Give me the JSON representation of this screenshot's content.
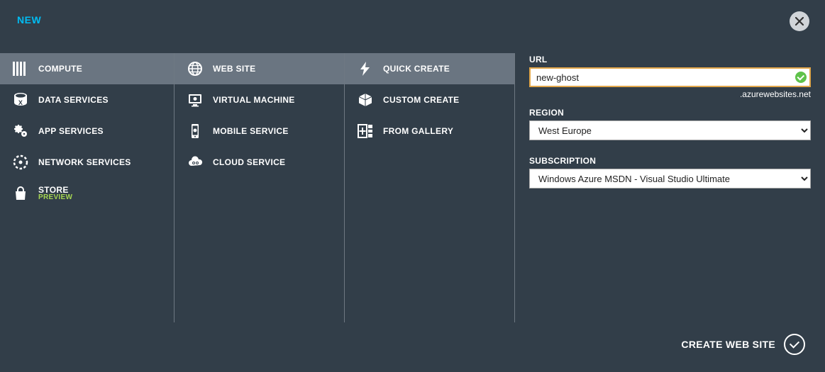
{
  "header": {
    "title": "NEW"
  },
  "col1": {
    "items": [
      {
        "label": "COMPUTE",
        "selected": true,
        "icon": "compute"
      },
      {
        "label": "DATA SERVICES",
        "icon": "data"
      },
      {
        "label": "APP SERVICES",
        "icon": "gears"
      },
      {
        "label": "NETWORK SERVICES",
        "icon": "circle-dashed"
      },
      {
        "label": "STORE",
        "sub": "PREVIEW",
        "icon": "bag"
      }
    ]
  },
  "col2": {
    "items": [
      {
        "label": "WEB SITE",
        "selected": true,
        "icon": "globe"
      },
      {
        "label": "VIRTUAL MACHINE",
        "icon": "monitor"
      },
      {
        "label": "MOBILE SERVICE",
        "icon": "phone"
      },
      {
        "label": "CLOUD SERVICE",
        "icon": "cloud"
      }
    ]
  },
  "col3": {
    "items": [
      {
        "label": "QUICK CREATE",
        "selected": true,
        "icon": "bolt"
      },
      {
        "label": "CUSTOM CREATE",
        "icon": "box"
      },
      {
        "label": "FROM GALLERY",
        "icon": "plus-panel"
      }
    ]
  },
  "form": {
    "url_label": "URL",
    "url_value": "new-ghost",
    "url_suffix": ".azurewebsites.net",
    "region_label": "REGION",
    "region_value": "West Europe",
    "subscription_label": "SUBSCRIPTION",
    "subscription_value": "Windows Azure MSDN - Visual Studio Ultimate"
  },
  "footer": {
    "submit_label": "CREATE WEB SITE"
  }
}
